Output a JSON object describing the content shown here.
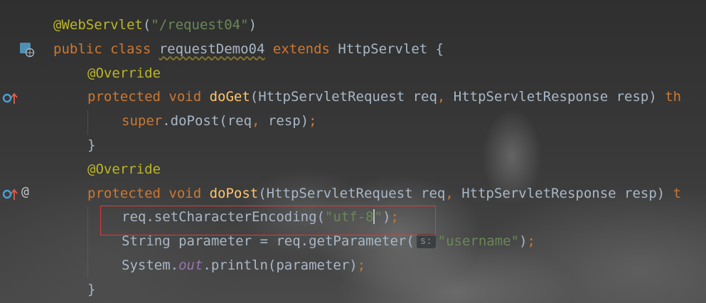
{
  "editor": {
    "lines": [
      {
        "indent": 0,
        "tokens": [
          {
            "t": "@WebServlet",
            "c": "ann"
          },
          {
            "t": "(",
            "c": "plain"
          },
          {
            "t": "\"/request04\"",
            "c": "str"
          },
          {
            "t": ")",
            "c": "plain"
          }
        ]
      },
      {
        "indent": 0,
        "tokens": [
          {
            "t": "public ",
            "c": "kw"
          },
          {
            "t": "class ",
            "c": "kw"
          },
          {
            "t": "requestDemo04",
            "c": "plain squig"
          },
          {
            "t": " extends ",
            "c": "kw"
          },
          {
            "t": "HttpServlet ",
            "c": "plain"
          },
          {
            "t": "{",
            "c": "plain"
          }
        ]
      },
      {
        "indent": 1,
        "tokens": [
          {
            "t": "@Override",
            "c": "ann"
          }
        ]
      },
      {
        "indent": 1,
        "tokens": [
          {
            "t": "protected ",
            "c": "kw"
          },
          {
            "t": "void ",
            "c": "kw"
          },
          {
            "t": "doGet",
            "c": "fn"
          },
          {
            "t": "(HttpServletRequest req",
            "c": "plain"
          },
          {
            "t": ", ",
            "c": "kw"
          },
          {
            "t": "HttpServletResponse resp) ",
            "c": "plain"
          },
          {
            "t": "th",
            "c": "kw"
          }
        ]
      },
      {
        "indent": 2,
        "tokens": [
          {
            "t": "super",
            "c": "kw"
          },
          {
            "t": ".doPost(req",
            "c": "plain"
          },
          {
            "t": ", ",
            "c": "kw"
          },
          {
            "t": "resp)",
            "c": "plain"
          },
          {
            "t": ";",
            "c": "kw"
          }
        ]
      },
      {
        "indent": 1,
        "tokens": [
          {
            "t": "}",
            "c": "plain"
          }
        ]
      },
      {
        "indent": 1,
        "tokens": [
          {
            "t": "@Override",
            "c": "ann"
          }
        ]
      },
      {
        "indent": 1,
        "tokens": [
          {
            "t": "protected ",
            "c": "kw"
          },
          {
            "t": "void ",
            "c": "kw"
          },
          {
            "t": "doPost",
            "c": "fn"
          },
          {
            "t": "(HttpServletRequest req",
            "c": "plain"
          },
          {
            "t": ", ",
            "c": "kw"
          },
          {
            "t": "HttpServletResponse resp) ",
            "c": "plain"
          },
          {
            "t": "t",
            "c": "kw"
          }
        ]
      },
      {
        "indent": 2,
        "tokens": [
          {
            "t": "req.setCharacterEncoding(",
            "c": "plain"
          },
          {
            "t": "\"utf-8",
            "c": "str"
          },
          {
            "caret": true
          },
          {
            "t": "\"",
            "c": "str"
          },
          {
            "t": ")",
            "c": "plain"
          },
          {
            "t": ";",
            "c": "kw"
          }
        ]
      },
      {
        "indent": 2,
        "tokens": [
          {
            "t": "String parameter = req.getParameter(",
            "c": "plain"
          },
          {
            "hint": "s:"
          },
          {
            "t": "\"username\"",
            "c": "str"
          },
          {
            "t": ")",
            "c": "plain"
          },
          {
            "t": ";",
            "c": "kw"
          }
        ]
      },
      {
        "indent": 2,
        "tokens": [
          {
            "t": "System.",
            "c": "plain"
          },
          {
            "t": "out",
            "c": "sfield"
          },
          {
            "t": ".println(parameter)",
            "c": "plain"
          },
          {
            "t": ";",
            "c": "kw"
          }
        ]
      },
      {
        "indent": 1,
        "tokens": [
          {
            "t": "}",
            "c": "plain"
          }
        ]
      }
    ]
  },
  "gutter": {
    "class_icon": "class-web-icon",
    "override_icon": "override-up-arrow-icon",
    "annotation_icon": "at-annotation-icon",
    "at_symbol": "@"
  },
  "colors": {
    "keyword": "#cc7832",
    "annotation": "#bbb529",
    "string": "#6a8759",
    "method": "#ffc66d",
    "plain": "#a9b7c6",
    "static_field": "#9876aa",
    "highlight_border": "#e03a3a"
  }
}
